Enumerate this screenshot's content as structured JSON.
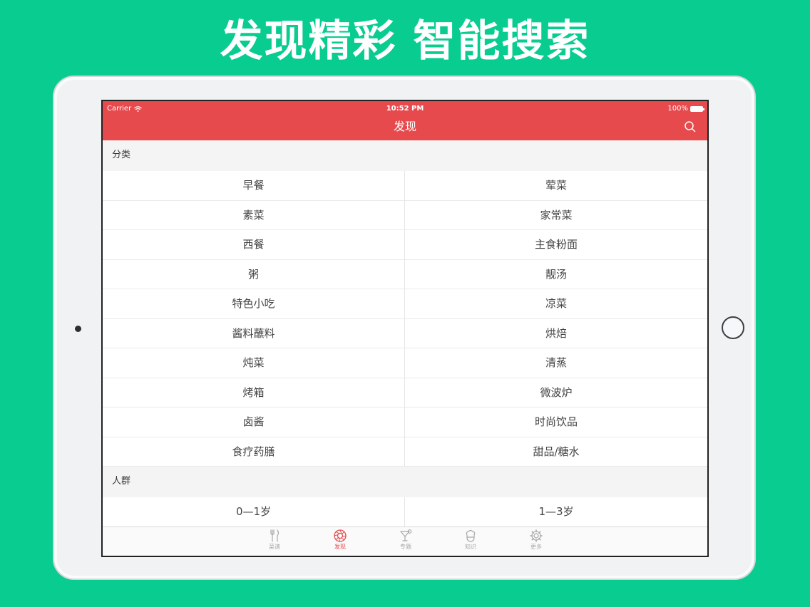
{
  "headline": "发现精彩 智能搜索",
  "status_bar": {
    "carrier": "Carrier",
    "time": "10:52 PM",
    "battery": "100%"
  },
  "nav": {
    "title": "发现"
  },
  "sections": [
    {
      "header": "分类",
      "items": [
        "早餐",
        "荤菜",
        "素菜",
        "家常菜",
        "西餐",
        "主食粉面",
        "粥",
        "靓汤",
        "特色小吃",
        "凉菜",
        "酱料蘸料",
        "烘焙",
        "炖菜",
        "清蒸",
        "烤箱",
        "微波炉",
        "卤酱",
        "时尚饮品",
        "食疗药膳",
        "甜品/糖水"
      ]
    },
    {
      "header": "人群",
      "items": [
        "0—1岁",
        "1—3岁"
      ]
    }
  ],
  "tabs": [
    {
      "label": "菜谱",
      "icon": "fork-knife-icon",
      "active": false
    },
    {
      "label": "发现",
      "icon": "aperture-icon",
      "active": true
    },
    {
      "label": "专题",
      "icon": "cocktail-icon",
      "active": false
    },
    {
      "label": "知识",
      "icon": "chef-hat-icon",
      "active": false
    },
    {
      "label": "更多",
      "icon": "gear-icon",
      "active": false
    }
  ],
  "colors": {
    "background": "#08cc90",
    "accent": "#e64a4d"
  }
}
